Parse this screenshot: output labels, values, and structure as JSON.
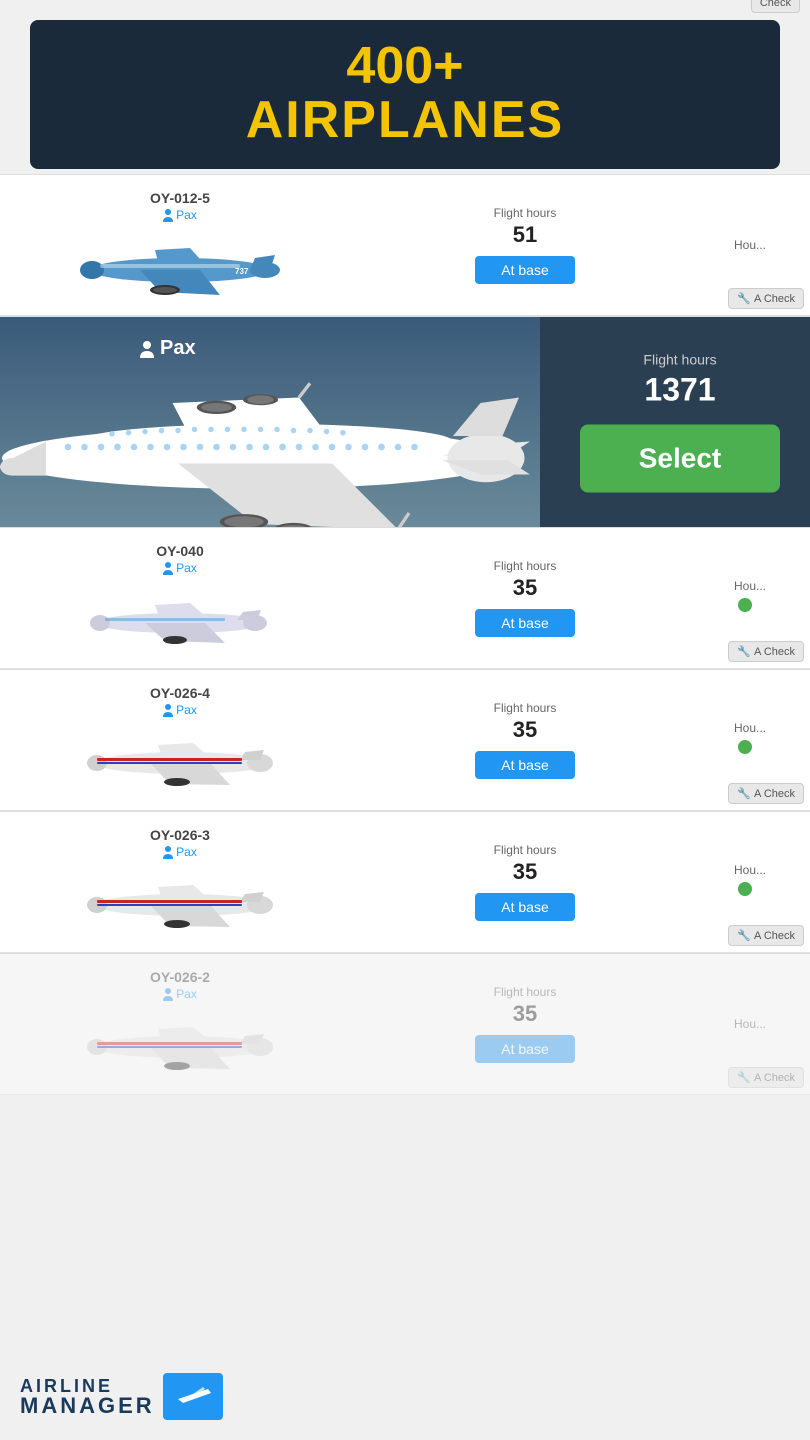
{
  "banner": {
    "line1": "400+",
    "line2": "AIRPLANES"
  },
  "expanded_plane": {
    "id": "expanded",
    "type": "Pax",
    "flight_hours_label": "Flight hours",
    "flight_hours_value": "1371",
    "select_label": "Select"
  },
  "planes": [
    {
      "id": "OY-012-5",
      "type": "Pax",
      "flight_hours_label": "Flight hours",
      "flight_hours_value": "51",
      "status": "At base",
      "hours_until_label": "Hou...",
      "a_check_label": "A Check"
    },
    {
      "id": "OY-040",
      "type": "Pax",
      "flight_hours_label": "Flight hours",
      "flight_hours_value": "35",
      "status": "At base",
      "hours_until_label": "Hou...",
      "a_check_label": "A Check",
      "has_green_dot": true
    },
    {
      "id": "OY-026-4",
      "type": "Pax",
      "flight_hours_label": "Flight hours",
      "flight_hours_value": "35",
      "status": "At base",
      "hours_until_label": "Hou...",
      "a_check_label": "A Check",
      "has_green_dot": true
    },
    {
      "id": "OY-026-3",
      "type": "Pax",
      "flight_hours_label": "Flight hours",
      "flight_hours_value": "35",
      "status": "At base",
      "hours_until_label": "Hou...",
      "a_check_label": "A Check",
      "has_green_dot": true
    },
    {
      "id": "OY-026-2",
      "type": "Pax",
      "flight_hours_label": "Flight hours",
      "flight_hours_value": "35",
      "status": "At base",
      "hours_until_label": "Hou...",
      "a_check_label": "A Check",
      "is_dimmed": true
    }
  ],
  "logo": {
    "line1": "AIRLINE",
    "line2": "MANAGER"
  }
}
